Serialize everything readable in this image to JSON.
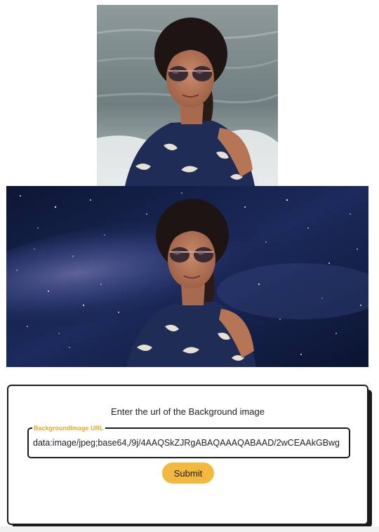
{
  "images": {
    "original_photo": "original-portrait-photo",
    "composited_photo": "portrait-on-galaxy-background"
  },
  "form": {
    "title": "Enter the url of the Background image",
    "field_label": "BackgroundImage URL",
    "field_value": "data:image/jpeg;base64,/9j/4AAQSkZJRgABAQAAAQABAAD/2wCEAAkGBwg",
    "submit_label": "Submit"
  },
  "colors": {
    "accent": "#f3b93f",
    "label": "#e8a825",
    "border": "#1b1b1b"
  }
}
